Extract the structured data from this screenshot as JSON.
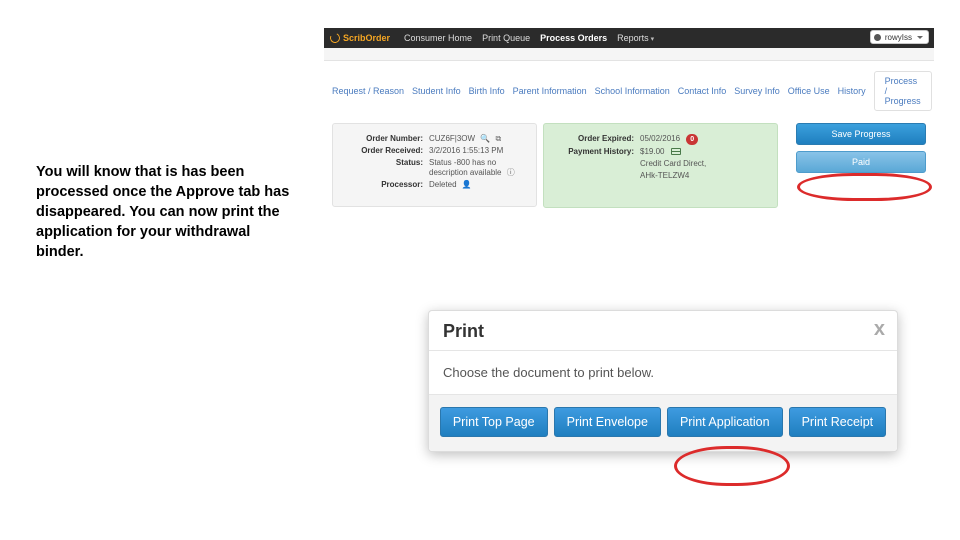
{
  "instruction_text": "You will know that is has been processed once the Approve tab has disappeared. You can now print the application for your withdrawal binder.",
  "brand": "ScribOrder",
  "topnav": {
    "items": [
      "Consumer Home",
      "Print Queue",
      "Process Orders",
      "Reports"
    ],
    "active_index": 2,
    "dropdown_indices": [
      3
    ]
  },
  "user_button": "rowyIss",
  "tabs": {
    "items": [
      "Request / Reason",
      "Student Info",
      "Birth Info",
      "Parent Information",
      "School Information",
      "Contact Info",
      "Survey Info",
      "Office Use",
      "History"
    ],
    "side_box": "Process / Progress"
  },
  "order_panel": {
    "number_label": "Order Number:",
    "number": "CUZ6F|3OW",
    "received_label": "Order Received:",
    "received": "3/2/2016 1:55:13 PM",
    "status_label": "Status:",
    "status": "Status -800 has no description available",
    "processor_label": "Processor:",
    "processor": "Deleted"
  },
  "expire_panel": {
    "expire_label": "Order Expired:",
    "expire": "05/02/2016",
    "expire_badge": "0",
    "history_label": "Payment History:",
    "amount": "$19.00",
    "method": "Credit Card Direct,",
    "ref": "AHk-TELZW4"
  },
  "actions": {
    "save": "Save Progress",
    "paid": "Paid"
  },
  "dialog": {
    "title": "Print",
    "close": "x",
    "body": "Choose the document to print below.",
    "buttons": [
      "Print Top Page",
      "Print Envelope",
      "Print Application",
      "Print Receipt"
    ]
  }
}
